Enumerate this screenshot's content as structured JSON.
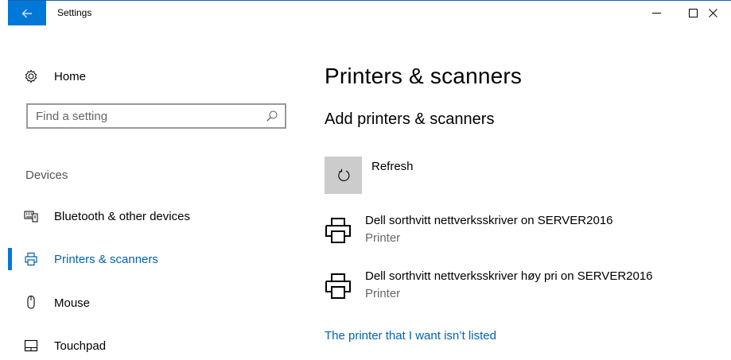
{
  "window": {
    "title": "Settings"
  },
  "sidebar": {
    "home_label": "Home",
    "search": {
      "placeholder": "Find a setting",
      "value": ""
    },
    "section_header": "Devices",
    "items": [
      {
        "label": "Bluetooth & other devices",
        "icon": "bluetooth-devices-icon",
        "selected": false
      },
      {
        "label": "Printers & scanners",
        "icon": "printer-icon",
        "selected": true
      },
      {
        "label": "Mouse",
        "icon": "mouse-icon",
        "selected": false
      },
      {
        "label": "Touchpad",
        "icon": "touchpad-icon",
        "selected": false
      }
    ]
  },
  "main": {
    "page_title": "Printers & scanners",
    "section_title": "Add printers & scanners",
    "refresh_label": "Refresh",
    "printers": [
      {
        "name": "Dell sorthvitt nettverksskriver on SERVER2016",
        "type": "Printer"
      },
      {
        "name": "Dell sorthvitt nettverksskriver høy pri on SERVER2016",
        "type": "Printer"
      }
    ],
    "not_listed_link": "The printer that I want isn’t listed"
  },
  "colors": {
    "accent": "#0078d7",
    "link": "#0063b1",
    "refresh_bg": "#cccccc"
  }
}
